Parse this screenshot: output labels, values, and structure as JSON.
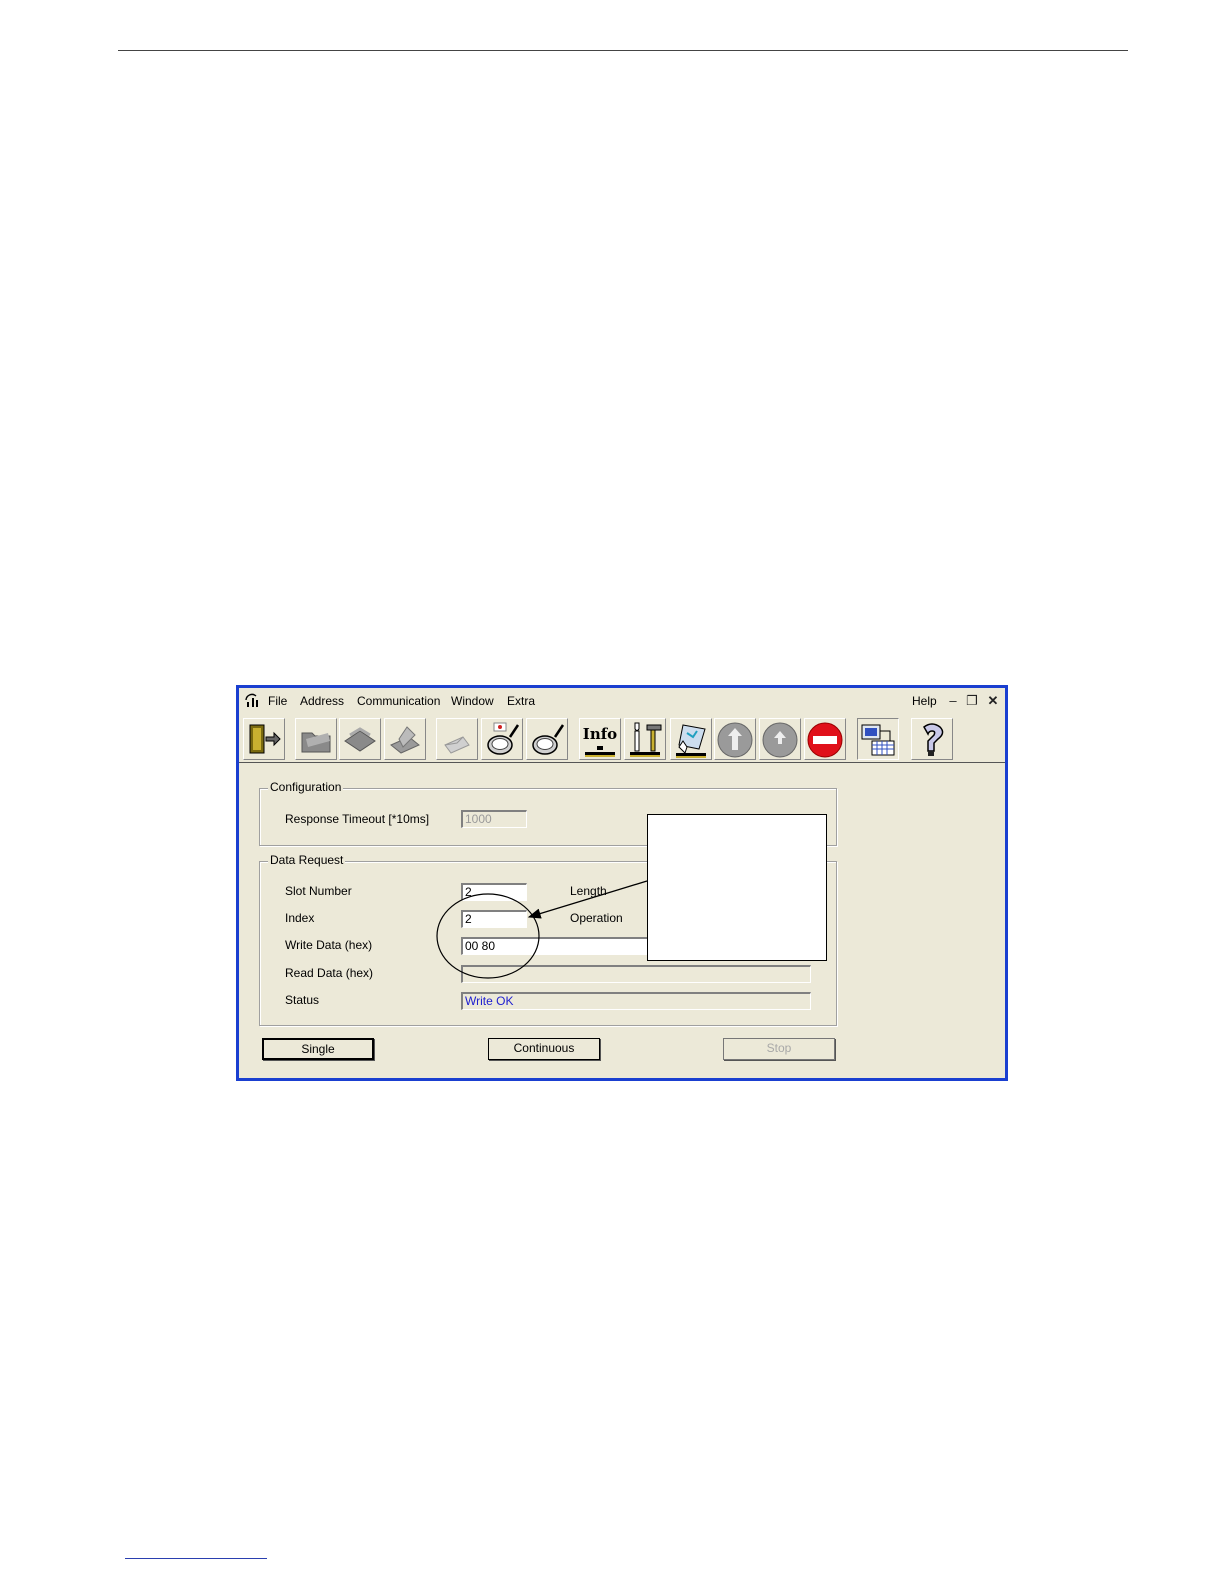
{
  "menu": {
    "file": "File",
    "address": "Address",
    "communication": "Communication",
    "window": "Window",
    "extra": "Extra",
    "help": "Help"
  },
  "toolbar": {
    "info_label": "Info"
  },
  "configuration": {
    "title": "Configuration",
    "timeout_label": "Response Timeout [*10ms]",
    "timeout_value": "1000"
  },
  "data_request": {
    "title": "Data Request",
    "slot_label": "Slot Number",
    "slot_value": "2",
    "index_label": "Index",
    "index_value": "2",
    "write_label": "Write Data (hex)",
    "write_value": "00 80",
    "read_label": "Read Data (hex)",
    "read_value": "",
    "status_label": "Status",
    "status_value": "Write OK",
    "length_label": "Length",
    "operation_label": "Operation"
  },
  "buttons": {
    "single": "Single",
    "continuous": "Continuous",
    "stop": "Stop"
  },
  "colors": {
    "window_border": "#1a3fd0",
    "window_bg": "#ece9d8",
    "status_text": "#2020d0",
    "stop_red": "#e0101a"
  }
}
